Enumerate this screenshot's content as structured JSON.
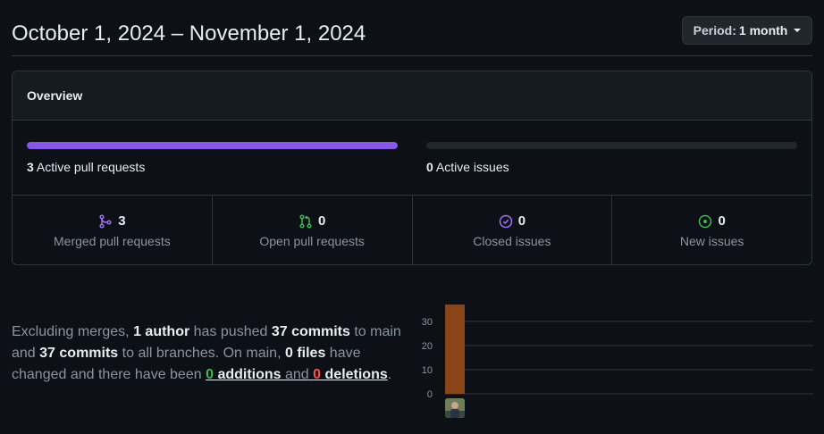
{
  "header": {
    "date_range": "October 1, 2024 – November 1, 2024",
    "period_label": "Period:",
    "period_value": "1 month"
  },
  "overview": {
    "title": "Overview",
    "pull_requests": {
      "count": "3",
      "label": "Active pull requests",
      "fill_fraction": 1.0
    },
    "issues": {
      "count": "0",
      "label": "Active issues",
      "fill_fraction": 0.0
    },
    "stats": [
      {
        "icon": "merged-pr-icon",
        "count": "3",
        "label": "Merged pull requests",
        "color": "#a371f7"
      },
      {
        "icon": "open-pr-icon",
        "count": "0",
        "label": "Open pull requests",
        "color": "#3fb950"
      },
      {
        "icon": "closed-issue-icon",
        "count": "0",
        "label": "Closed issues",
        "color": "#a371f7"
      },
      {
        "icon": "new-issue-icon",
        "count": "0",
        "label": "New issues",
        "color": "#3fb950"
      }
    ]
  },
  "summary": {
    "t1": "Excluding merges,",
    "authors": "1 author",
    "t2": "has pushed",
    "commits_main": "37 commits",
    "t3": "to main and",
    "commits_all": "37 commits",
    "t4": "to all branches. On main,",
    "files": "0 files",
    "t5": "have changed and there have been",
    "additions_count": "0",
    "additions_word": "additions",
    "t6": "and",
    "deletions_count": "0",
    "deletions_word": "deletions",
    "t7": "."
  },
  "chart_data": {
    "type": "bar",
    "categories": [
      "author-1"
    ],
    "values": [
      37
    ],
    "ylim": [
      0,
      37
    ],
    "yticks": [
      "0",
      "10",
      "20",
      "30"
    ],
    "bar_color": "#8b4419",
    "grid": true
  }
}
